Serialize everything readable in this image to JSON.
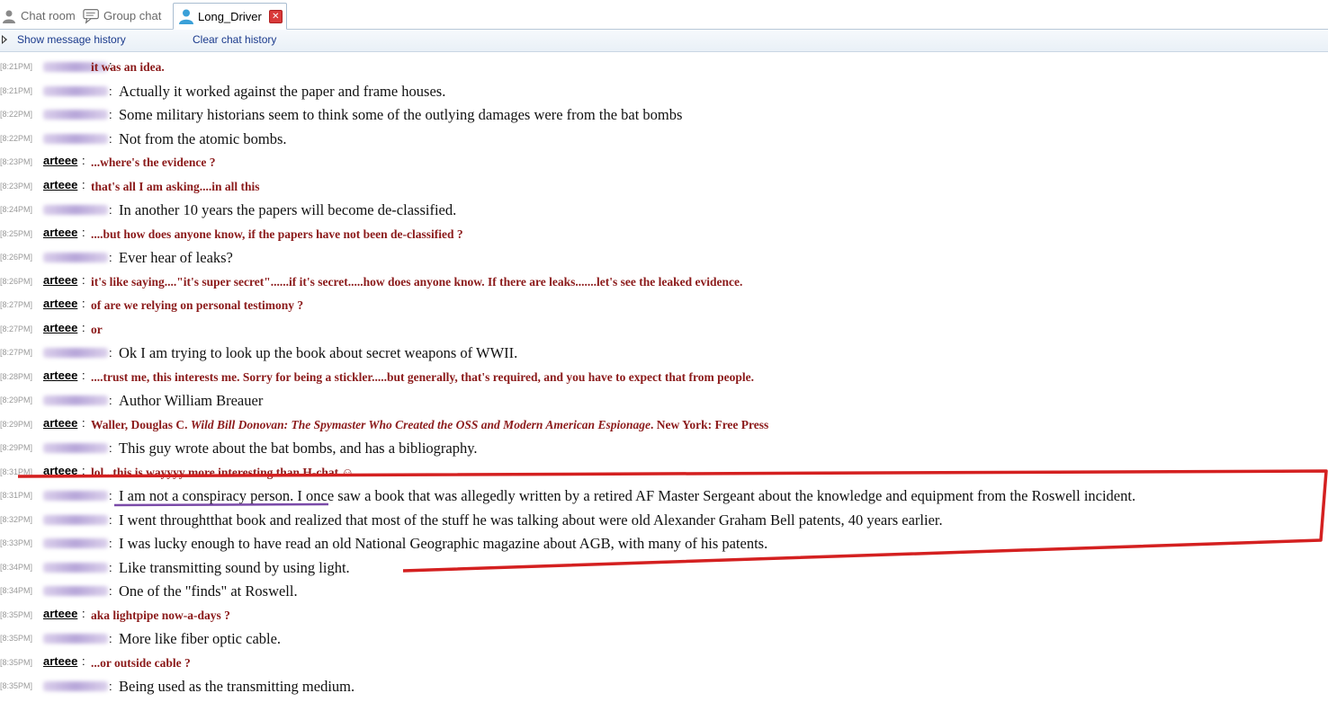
{
  "tabs": [
    {
      "label": "Chat room",
      "icon": "person-icon"
    },
    {
      "label": "Group chat",
      "icon": "speech-bubble-icon"
    },
    {
      "label": "Long_Driver",
      "icon": "user-icon",
      "active": true
    }
  ],
  "toolbar": {
    "show_history": "Show message history",
    "clear_history": "Clear chat history"
  },
  "colors": {
    "arteee_text": "#8b1a1a",
    "annotation": "#d42020",
    "underline": "#7a4aa8"
  },
  "messages": [
    {
      "time": "[8:21PM]",
      "user": "",
      "redacted": true,
      "kind": "a",
      "text": "it was an idea."
    },
    {
      "time": "[8:21PM]",
      "user": "",
      "redacted": true,
      "kind": "l",
      "text": "Actually it worked against the paper and frame houses."
    },
    {
      "time": "[8:22PM]",
      "user": "",
      "redacted": true,
      "kind": "l",
      "text": "Some military historians seem to think some of the outlying damages were from the bat bombs"
    },
    {
      "time": "[8:22PM]",
      "user": "",
      "redacted": true,
      "kind": "l",
      "text": "Not from the atomic bombs."
    },
    {
      "time": "[8:23PM]",
      "user": "arteee",
      "redacted": false,
      "kind": "a",
      "text": "...where's the evidence ?"
    },
    {
      "time": "[8:23PM]",
      "user": "arteee",
      "redacted": false,
      "kind": "a",
      "text": "that's all I am asking....in all this"
    },
    {
      "time": "[8:24PM]",
      "user": "",
      "redacted": true,
      "kind": "l",
      "text": "In another 10 years the papers will become de-classified."
    },
    {
      "time": "[8:25PM]",
      "user": "arteee",
      "redacted": false,
      "kind": "a",
      "text": "....but how does anyone know, if the papers have not been de-classified ?"
    },
    {
      "time": "[8:26PM]",
      "user": "",
      "redacted": true,
      "kind": "l",
      "text": "Ever hear of leaks?"
    },
    {
      "time": "[8:26PM]",
      "user": "arteee",
      "redacted": false,
      "kind": "a",
      "text": "it's like saying....\"it's super secret\"......if it's secret.....how does anyone know. If there are leaks.......let's see the leaked evidence."
    },
    {
      "time": "[8:27PM]",
      "user": "arteee",
      "redacted": false,
      "kind": "a",
      "text": "of are we relying on personal testimony ?"
    },
    {
      "time": "[8:27PM]",
      "user": "arteee",
      "redacted": false,
      "kind": "a",
      "text": "or"
    },
    {
      "time": "[8:27PM]",
      "user": "",
      "redacted": true,
      "kind": "l",
      "text": "Ok I am trying to look up the book about secret weapons of WWII."
    },
    {
      "time": "[8:28PM]",
      "user": "arteee",
      "redacted": false,
      "kind": "a",
      "text": "....trust me, this interests me. Sorry for being a stickler.....but generally, that's required, and you have to expect that from people."
    },
    {
      "time": "[8:29PM]",
      "user": "",
      "redacted": true,
      "kind": "l",
      "text": "Author William Breauer"
    },
    {
      "time": "[8:29PM]",
      "user": "arteee",
      "redacted": false,
      "kind": "a",
      "text": "Waller, Douglas C. ",
      "italic": "Wild Bill Donovan: The Spymaster Who Created the OSS and Modern American Espionage",
      "tail": ". New York: Free Press"
    },
    {
      "time": "[8:29PM]",
      "user": "",
      "redacted": true,
      "kind": "l",
      "text": "This guy wrote about the bat bombs, and has a bibliography."
    },
    {
      "time": "[8:31PM]",
      "user": "arteee",
      "redacted": false,
      "kind": "a",
      "text": "lol...this is wayyyy more interesting than H-chat ☺"
    },
    {
      "time": "[8:31PM]",
      "user": "",
      "redacted": true,
      "kind": "l",
      "text": "I am not a conspiracy person. I once saw a book that was allegedly written by a retired AF Master Sergeant about the knowledge and equipment from the Roswell incident."
    },
    {
      "time": "[8:32PM]",
      "user": "",
      "redacted": true,
      "kind": "l",
      "text": "I went throughtthat book and realized that most of the stuff he was talking about were old Alexander Graham Bell patents, 40 years earlier."
    },
    {
      "time": "[8:33PM]",
      "user": "",
      "redacted": true,
      "kind": "l",
      "text": "I was lucky enough to have read an old National Geographic magazine about AGB, with many of his patents."
    },
    {
      "time": "[8:34PM]",
      "user": "",
      "redacted": true,
      "kind": "l",
      "text": "Like transmitting sound by using light."
    },
    {
      "time": "[8:34PM]",
      "user": "",
      "redacted": true,
      "kind": "l",
      "text": "One of the \"finds\" at Roswell."
    },
    {
      "time": "[8:35PM]",
      "user": "arteee",
      "redacted": false,
      "kind": "a",
      "text": "aka lightpipe now-a-days ?"
    },
    {
      "time": "[8:35PM]",
      "user": "",
      "redacted": true,
      "kind": "l",
      "text": "More like fiber optic cable."
    },
    {
      "time": "[8:35PM]",
      "user": "arteee",
      "redacted": false,
      "kind": "a",
      "text": "...or outside cable ?"
    },
    {
      "time": "[8:35PM]",
      "user": "",
      "redacted": true,
      "kind": "l",
      "text": "Being used as the transmitting medium."
    }
  ]
}
